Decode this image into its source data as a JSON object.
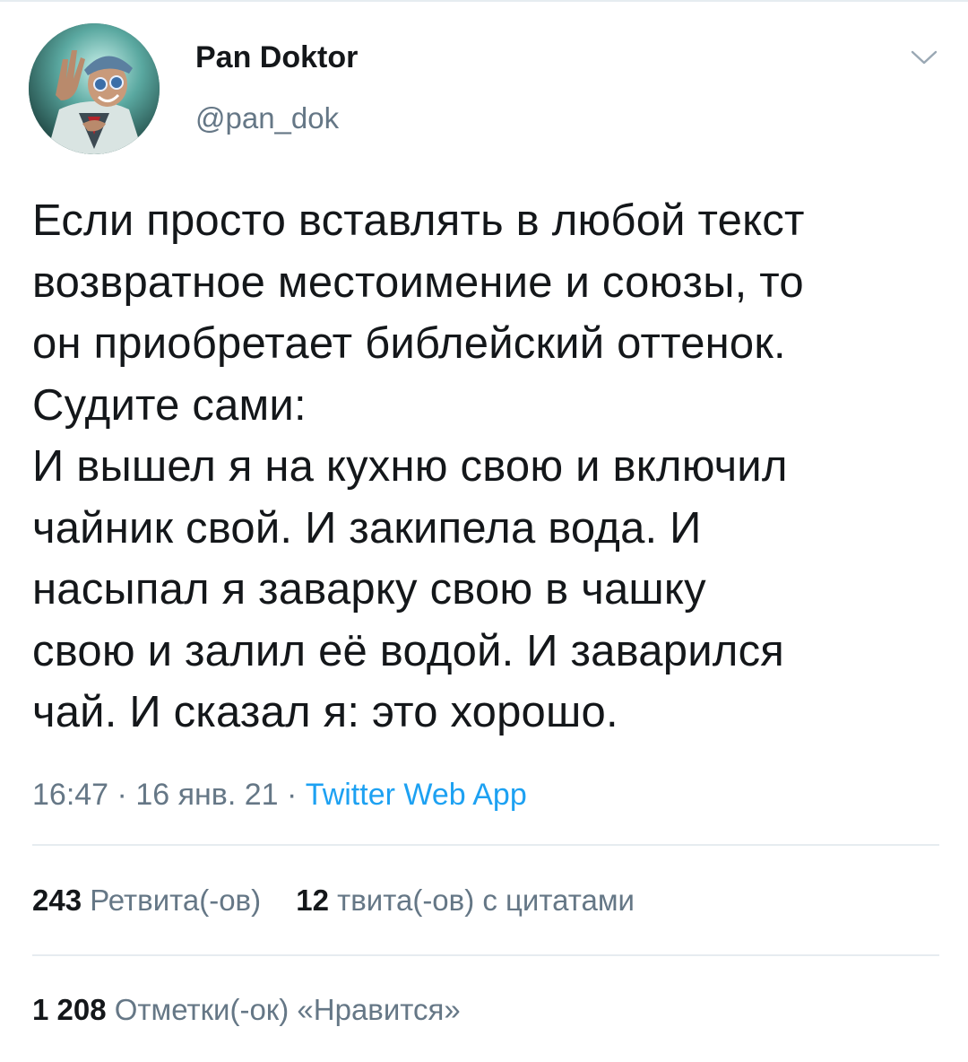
{
  "author": {
    "name": "Pan Doktor",
    "handle": "@pan_dok"
  },
  "tweet": {
    "text": "Если просто вставлять в любой текст\nвозвратное местоимение и союзы, то\nон приобретает библейский оттенок.\nСудите сами:\nИ вышел я на кухню свою и включил\nчайник свой. И закипела вода. И\nнасыпал я заварку свою в чашку\nсвою и залил её водой. И заварился\nчай. И сказал я: это хорошо.",
    "time": "16:47",
    "separator": "·",
    "date": "16 янв. 21",
    "source": "Twitter Web App"
  },
  "stats": {
    "retweets_count": "243",
    "retweets_label": "Ретвита(-ов)",
    "quotes_count": "12",
    "quotes_label": "твита(-ов) с цитатами",
    "likes_count": "1 208",
    "likes_label": "Отметки(-ок) «Нравится»"
  },
  "icons": {
    "menu": "chevron-down-icon",
    "avatar": "profile-avatar"
  },
  "colors": {
    "text": "#14171a",
    "secondary": "#657786",
    "link": "#1da1f2",
    "divider": "#e6ecf0"
  }
}
